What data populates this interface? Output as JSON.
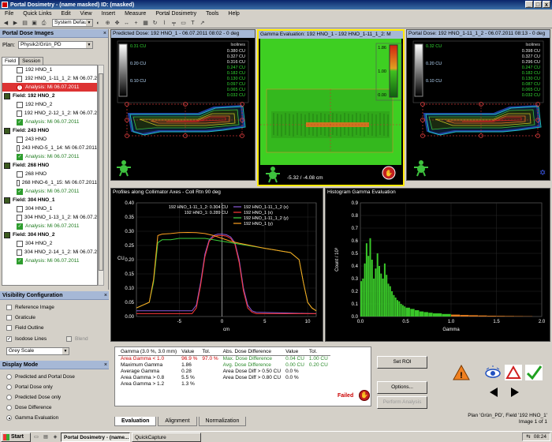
{
  "window": {
    "title": "Portal Dosimetry - (name masked)  ID: (masked)",
    "controls": [
      "_",
      "□",
      "x"
    ]
  },
  "menu": [
    {
      "label": "File"
    },
    {
      "label": "Quick Links"
    },
    {
      "label": "Edit"
    },
    {
      "label": "View"
    },
    {
      "label": "Insert"
    },
    {
      "label": "Measure"
    },
    {
      "label": "Portal Dosimetry"
    },
    {
      "label": "Tools"
    },
    {
      "label": "Help"
    }
  ],
  "toolbar": {
    "layout_select": "System Default"
  },
  "left_panel": {
    "header": "Portal Dose Images",
    "plan_label": "Plan:",
    "plan_value": "Physik2/Grün_PD",
    "tabs": [
      "Field",
      "Session"
    ],
    "tree": [
      {
        "type": "img",
        "text": "192 HNO_1"
      },
      {
        "type": "img",
        "text": "192 HNO_1-11_1_2: Mi 06.07.2"
      },
      {
        "type": "ana-sel",
        "text": "Analysis: Mi 06.07.2011"
      },
      {
        "type": "field",
        "text": "Field: 192 HNO_2"
      },
      {
        "type": "img",
        "text": "192 HNO_2"
      },
      {
        "type": "img",
        "text": "192 HNO_2-12_1_2: Mi 06.07.2"
      },
      {
        "type": "ana",
        "text": "Analysis: Mi 06.07.2011"
      },
      {
        "type": "field",
        "text": "Field: 243 HNO"
      },
      {
        "type": "img",
        "text": "243 HNO"
      },
      {
        "type": "img",
        "text": "243 HNO-5_1_14: Mi 06.07.2011"
      },
      {
        "type": "ana",
        "text": "Analysis: Mi 06.07.2011"
      },
      {
        "type": "field",
        "text": "Field: 268 HNO"
      },
      {
        "type": "img",
        "text": "268 HNO"
      },
      {
        "type": "img",
        "text": "268 HNO-6_1_15: Mi 06.07.2011"
      },
      {
        "type": "ana",
        "text": "Analysis: Mi 06.07.2011"
      },
      {
        "type": "field",
        "text": "Field: 304 HNO_1"
      },
      {
        "type": "img",
        "text": "304 HNO_1"
      },
      {
        "type": "img",
        "text": "304 HNO_1-13_1_2: Mi 06.07.2"
      },
      {
        "type": "ana",
        "text": "Analysis: Mi 06.07.2011"
      },
      {
        "type": "field",
        "text": "Field: 304 HNO_2"
      },
      {
        "type": "img",
        "text": "304 HNO_2"
      },
      {
        "type": "img",
        "text": "304 HNO_2-14_1_2: Mi 06.07.2"
      },
      {
        "type": "ana",
        "text": "Analysis: Mi 06.07.2011"
      }
    ]
  },
  "visibility": {
    "header": "Visibility Configuration",
    "reference_image": "Reference Image",
    "graticule": "Graticule",
    "field_outline": "Field Outline",
    "isodose_lines": "Isodose Lines",
    "blend": "Blend",
    "color_scheme": "Grey Scale"
  },
  "display_mode": {
    "header": "Display Mode",
    "options": [
      {
        "label": "Predicted and Portal Dose",
        "selected": false
      },
      {
        "label": "Portal Dose only",
        "selected": false
      },
      {
        "label": "Predicted Dose only",
        "selected": false
      },
      {
        "label": "Dose Difference",
        "selected": false
      },
      {
        "label": "Gamma Evaluation",
        "selected": true
      }
    ]
  },
  "panes": {
    "predicted": {
      "title": "Predicted Dose: 192 HNO_1 - 06.07.2011 08:02 - 0 deg",
      "legend_header": "Isolines",
      "legend": [
        "0.380 CU",
        "0.327 CU",
        "0.316 CU",
        "0.247 CU",
        "0.182 CU",
        "0.130 CU",
        "0.097 CU",
        "0.065 CU",
        "0.032 CU"
      ],
      "scale": [
        "0.31 CU",
        "0.20 CU",
        "0.10 CU"
      ]
    },
    "gamma": {
      "title": "Gamma Evaluation: 192 HNO_1 - 192 HNO_1-11_1_2: M",
      "scale": [
        "1.86",
        "1.00",
        "0.00"
      ],
      "cursor_readout": "-5.32 / -4.08 cm"
    },
    "portal": {
      "title": "Portal Dose: 192 HNO_1-11_1_2 - 06.07.2011 08:13 - 0 deg",
      "legend_header": "Isolines",
      "legend": [
        "0.398 CU",
        "0.327 CU",
        "0.296 CU",
        "0.247 CU",
        "0.182 CU",
        "0.130 CU",
        "0.087 CU",
        "0.065 CU",
        "0.032 CU"
      ],
      "scale": [
        "0.32 CU",
        "0.20 CU",
        "0.10 CU"
      ]
    }
  },
  "profiles": {
    "title": "Profiles along Collimator Axes - Coll Rtn 90 deg",
    "readout": [
      "192 HNO_1-11_1_2: 0.304 CU",
      "192 HNO_1: 0.289 CU"
    ],
    "legend": [
      "192 HNO_1-11_1_2 (x)",
      "192 HNO_1 (x)",
      "192 HNO_1-11_1_2 (y)",
      "192 HNO_1 (y)"
    ],
    "legend_colors": [
      "#8a5ad8",
      "#ff3a3a",
      "#3cd03c",
      "#ffa020"
    ]
  },
  "histogram": {
    "title": "Histogram Gamma Evaluation"
  },
  "chart_data": [
    {
      "type": "line",
      "title": "Profiles along Collimator Axes - Coll Rtn 90 deg",
      "xlabel": "cm",
      "ylabel": "CU",
      "xlim": [
        -10,
        11
      ],
      "ylim": [
        0,
        0.4
      ],
      "xticks": [
        -5,
        0,
        5,
        10
      ],
      "yticks": [
        0,
        0.05,
        0.1,
        0.15,
        0.2,
        0.25,
        0.3,
        0.35,
        0.4
      ],
      "series": [
        {
          "name": "192 HNO_1-11_1_2 (x)",
          "color": "#8a5ad8",
          "x": [
            -10,
            -3.5,
            -3,
            -2.5,
            -2,
            -1.5,
            -1,
            -0.5,
            0,
            0.5,
            1,
            1.5,
            2,
            2.5,
            3,
            3.5,
            4,
            11
          ],
          "y": [
            0.02,
            0.02,
            0.04,
            0.12,
            0.22,
            0.27,
            0.285,
            0.29,
            0.29,
            0.288,
            0.28,
            0.26,
            0.2,
            0.1,
            0.04,
            0.02,
            0.015,
            0.01
          ]
        },
        {
          "name": "192 HNO_1 (x)",
          "color": "#ff3a3a",
          "x": [
            -10,
            -3.5,
            -3,
            -2.5,
            -2,
            -1.5,
            -1,
            -0.5,
            0,
            0.5,
            1,
            1.5,
            2,
            2.5,
            3,
            3.5,
            4,
            11
          ],
          "y": [
            0.01,
            0.01,
            0.03,
            0.11,
            0.21,
            0.265,
            0.28,
            0.285,
            0.285,
            0.283,
            0.275,
            0.255,
            0.19,
            0.09,
            0.03,
            0.015,
            0.01,
            0.01
          ]
        },
        {
          "name": "192 HNO_1-11_1_2 (y)",
          "color": "#3cd03c",
          "x": [
            -10,
            -8.5,
            -8,
            -7.5,
            -7,
            -6,
            -5,
            -4,
            -3,
            -2,
            -1,
            0,
            1,
            2,
            3,
            4,
            5,
            6,
            7,
            8,
            9,
            9.5,
            10,
            10.5,
            11
          ],
          "y": [
            0.03,
            0.05,
            0.12,
            0.26,
            0.27,
            0.27,
            0.275,
            0.275,
            0.275,
            0.275,
            0.27,
            0.265,
            0.26,
            0.255,
            0.25,
            0.245,
            0.24,
            0.235,
            0.23,
            0.225,
            0.2,
            0.12,
            0.05,
            0.03,
            0.02
          ]
        },
        {
          "name": "192 HNO_1 (y)",
          "color": "#ffa020",
          "x": [
            -10,
            -8.5,
            -8,
            -7.5,
            -7,
            -6,
            -5,
            -4,
            -3,
            -2,
            -1,
            0,
            1,
            2,
            3,
            4,
            5,
            6,
            7,
            8,
            9,
            9.5,
            10,
            10.5,
            11
          ],
          "y": [
            0.03,
            0.05,
            0.13,
            0.285,
            0.29,
            0.292,
            0.295,
            0.296,
            0.295,
            0.292,
            0.285,
            0.275,
            0.265,
            0.258,
            0.252,
            0.246,
            0.24,
            0.235,
            0.23,
            0.225,
            0.2,
            0.12,
            0.05,
            0.03,
            0.02
          ]
        }
      ]
    },
    {
      "type": "bar",
      "title": "Histogram Gamma Evaluation",
      "xlabel": "Gamma",
      "ylabel": "Count / 10³",
      "xlim": [
        0,
        2.0
      ],
      "ylim": [
        0,
        0.9
      ],
      "xticks": [
        0,
        0.5,
        1.0,
        1.5,
        2.0
      ],
      "yticks": [
        0,
        0.1,
        0.2,
        0.3,
        0.4,
        0.5,
        0.6,
        0.7,
        0.8,
        0.9
      ],
      "bins": [
        0.0,
        0.02,
        0.04,
        0.06,
        0.08,
        0.1,
        0.12,
        0.14,
        0.16,
        0.18,
        0.2,
        0.22,
        0.24,
        0.26,
        0.28,
        0.3,
        0.32,
        0.34,
        0.36,
        0.38,
        0.4,
        0.42,
        0.44,
        0.46,
        0.48,
        0.5,
        0.55,
        0.6,
        0.65,
        0.7,
        0.75,
        0.8,
        0.9,
        1.0,
        1.1,
        1.2,
        1.3,
        1.4,
        1.5,
        1.6,
        1.7,
        1.8
      ],
      "values": [
        0.28,
        0.3,
        0.42,
        0.58,
        0.48,
        0.62,
        0.45,
        0.3,
        0.38,
        0.5,
        0.4,
        0.34,
        0.3,
        0.42,
        0.33,
        0.26,
        0.24,
        0.2,
        0.17,
        0.15,
        0.13,
        0.12,
        0.1,
        0.09,
        0.08,
        0.07,
        0.06,
        0.05,
        0.04,
        0.035,
        0.03,
        0.025,
        0.02,
        0.015,
        0.012,
        0.01,
        0.008,
        0.006,
        0.005,
        0.004,
        0.003,
        0.002
      ],
      "colors": {
        "pass": "#39c629",
        "fail": "#e67d1e"
      },
      "pass_limit": 1.0
    }
  ],
  "results": {
    "headers": [
      "Gamma (3.0 %, 3.0 mm)",
      "Value",
      "Tol.",
      "Abs. Dose Difference",
      "Value",
      "Tol."
    ],
    "rows": [
      {
        "label": "Area Gamma < 1.0",
        "value": "96.9 %",
        "tol": "97.0 %",
        "dlabel": "Max. Dose Difference",
        "dvalue": "0.04 CU",
        "dtol": "1.00 CU"
      },
      {
        "label": "Maximum Gamma",
        "value": "1.86",
        "tol": "",
        "dlabel": "Avg. Dose Difference",
        "dvalue": "0.00 CU",
        "dtol": "0.20 CU"
      },
      {
        "label": "Average Gamma",
        "value": "0.28",
        "tol": "",
        "dlabel": "Area Dose Diff > 0.50 CU",
        "dvalue": "0.0 %",
        "dtol": ""
      },
      {
        "label": "Area Gamma > 0.8",
        "value": "5.5 %",
        "tol": "",
        "dlabel": "Area Dose Diff > 0.80 CU",
        "dvalue": "0.0 %",
        "dtol": ""
      },
      {
        "label": "Area Gamma > 1.2",
        "value": "1.3 %",
        "tol": "",
        "dlabel": "",
        "dvalue": "",
        "dtol": ""
      }
    ],
    "status": "Failed"
  },
  "buttons": {
    "set_roi": "Set ROI",
    "options": "Options...",
    "perform_analysis": "Perform Analysis"
  },
  "bottom_tabs": [
    "Evaluation",
    "Alignment",
    "Normalization"
  ],
  "status": {
    "line1": "Plan 'Grün_PD', Field '192 HNO_1'",
    "line2": "Image 1 of 1"
  },
  "taskbar": {
    "start": "Start",
    "tasks": [
      "Portal Dosimetry - (name...",
      "QuickCapture"
    ],
    "clock": "08:24"
  }
}
